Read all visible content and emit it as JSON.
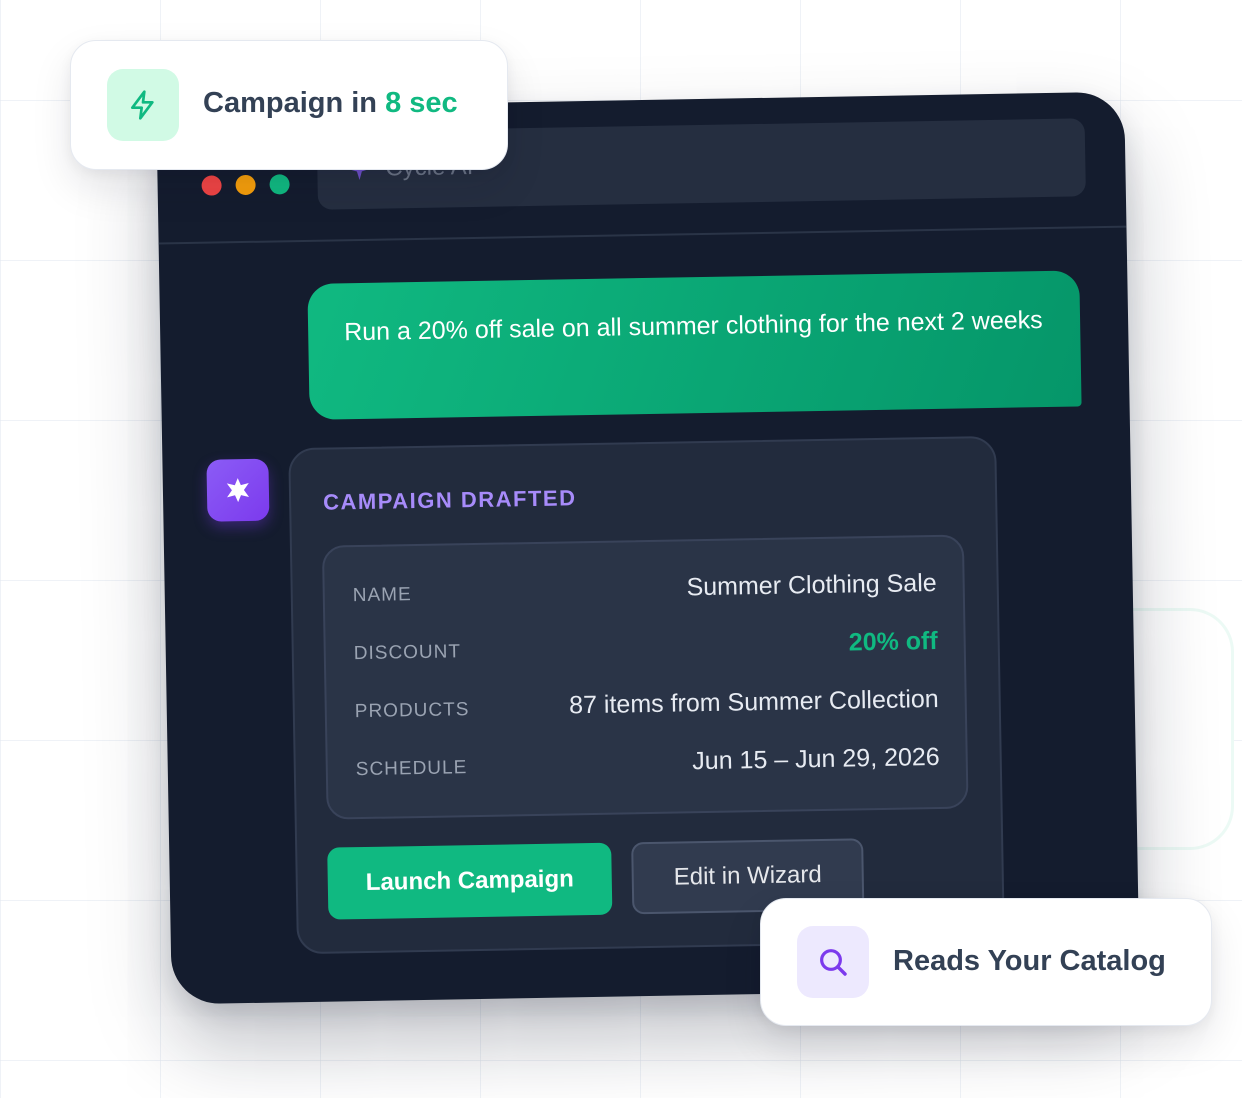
{
  "window": {
    "address_bar": {
      "icon": "sparkle-icon",
      "text": "Cycle AI"
    },
    "traffic_lights": [
      "#ef4444",
      "#f59e0b",
      "#10b981"
    ]
  },
  "chat": {
    "user_message": "Run a 20% off sale on all summer clothing for the next 2 weeks",
    "assistant": {
      "avatar_icon": "sparkle-icon",
      "card_title": "CAMPAIGN DRAFTED",
      "details": [
        {
          "label": "NAME",
          "value": "Summer Clothing Sale"
        },
        {
          "label": "DISCOUNT",
          "value": "20% off"
        },
        {
          "label": "PRODUCTS",
          "value": "87 items from Summer Collection"
        },
        {
          "label": "SCHEDULE",
          "value": "Jun 15 – Jun 29, 2026"
        }
      ],
      "primary_button": "Launch Campaign",
      "secondary_button": "Edit in Wizard"
    }
  },
  "badges": {
    "speed": {
      "icon": "lightning-icon",
      "prefix": "Campaign in ",
      "highlight": "8 sec"
    },
    "catalog": {
      "icon": "search-icon",
      "text": "Reads Your Catalog"
    }
  },
  "colors": {
    "accent_green": "#10b981",
    "accent_purple": "#8b5cf6",
    "window_bg": "#141c2e",
    "card_bg": "#222b3d"
  }
}
